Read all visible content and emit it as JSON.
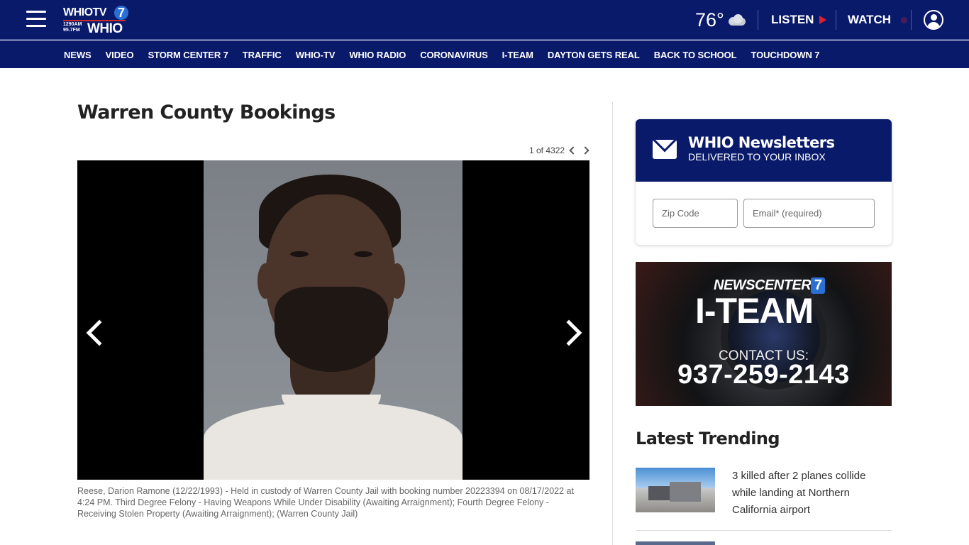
{
  "header": {
    "logo": {
      "tv": "WHIOTV",
      "seven": "7",
      "freq_am": "1290AM",
      "freq_fm": "95.7FM",
      "radio": "WHIO"
    },
    "weather": {
      "temperature": "76°",
      "icon": "partly-cloudy-icon"
    },
    "listen_label": "LISTEN",
    "watch_label": "WATCH"
  },
  "nav": {
    "items": [
      "NEWS",
      "VIDEO",
      "STORM CENTER 7",
      "TRAFFIC",
      "WHIO-TV",
      "WHIO RADIO",
      "CORONAVIRUS",
      "I-TEAM",
      "DAYTON GETS REAL",
      "BACK TO SCHOOL",
      "TOUCHDOWN 7"
    ]
  },
  "main": {
    "title": "Warren County Bookings",
    "counter": "1 of 4322",
    "caption": "Reese, Darion Ramone (12/22/1993) - Held in custody of Warren County Jail with booking number 20223394 on 08/17/2022 at 4:24 PM. Third Degree Felony - Having Weapons While Under Disability (Awaiting Arraignment); Fourth Degree Felony - Receiving Stolen Property (Awaiting Arraignment); (Warren County Jail)"
  },
  "sidebar": {
    "newsletter": {
      "title": "WHIO Newsletters",
      "subtitle": "DELIVERED TO YOUR INBOX",
      "zip_placeholder": "Zip Code",
      "email_placeholder": "Email* (required)"
    },
    "promo": {
      "brand": "NEWSCENTER",
      "seven": "7",
      "team": "I-TEAM",
      "contact": "CONTACT US:",
      "phone": "937-259-2143"
    },
    "trending": {
      "title": "Latest Trending",
      "stories": [
        {
          "headline": "3 killed after 2 planes collide while landing at Northern California airport"
        }
      ]
    }
  },
  "colors": {
    "brand_navy": "#0a1a6b",
    "accent_red": "#e0202a",
    "logo_blue": "#2a6fd6"
  }
}
